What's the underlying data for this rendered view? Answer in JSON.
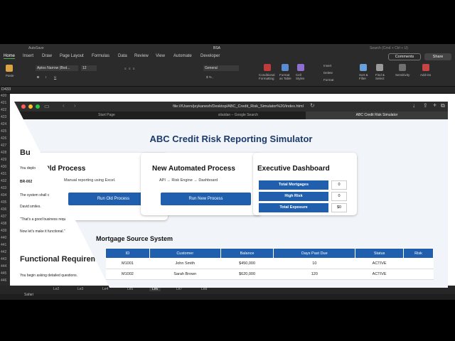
{
  "excel": {
    "autosave_label": "AutoSave",
    "file_name": "BSA",
    "search_placeholder": "Search (Cmd + Ctrl + U)",
    "ribbon_tabs": [
      "Home",
      "Insert",
      "Draw",
      "Page Layout",
      "Formulas",
      "Data",
      "Review",
      "View",
      "Automate",
      "Developer"
    ],
    "comments_label": "Comments",
    "share_label": "Share",
    "paste_label": "Paste",
    "font_name": "Aptos Narrow (Bod...",
    "font_size": "12",
    "number_format": "General",
    "insert_label": "Insert",
    "delete_label": "Delete",
    "format_label": "Format",
    "conditional_label": "Conditional Formatting",
    "format_table_label": "Format as Table",
    "cell_styles_label": "Cell Styles",
    "sort_label": "Sort & Filter",
    "find_label": "Find & Select",
    "sensitivity_label": "Sensitivity",
    "addins_label": "Add-ins",
    "name_box": "D433",
    "row_numbers": [
      "420",
      "421",
      "422",
      "423",
      "424",
      "425",
      "426",
      "427",
      "428",
      "429",
      "430",
      "431",
      "432",
      "433",
      "434",
      "435",
      "436",
      "437",
      "438",
      "439",
      "440",
      "441",
      "442",
      "443",
      "444",
      "445",
      "446"
    ],
    "doc_lines": {
      "heading1": "Bu",
      "l1": "You deplo",
      "l2": "BR-002",
      "l3": "The system shall c",
      "l4": "David smiles.",
      "l5": "“That's a good business requ",
      "l6": "Now let's make it functional.”",
      "heading2": "Functional Requireme",
      "l7": "You begin asking detailed questions."
    },
    "sheet_tabs": [
      "Le2",
      "Le3",
      "Le4",
      "Le5",
      "Le6",
      "Le7",
      "Le8"
    ],
    "active_sheet": "Le6",
    "dock_label": "Safari"
  },
  "safari": {
    "url": "file:///Users/jeykanesh/Desktop/ABC_Credit_Risk_Simulator%20/index.html",
    "tabs": [
      "Start Page",
      "sitaidan – Google Search",
      "ABC Credit Risk Simulator"
    ]
  },
  "page": {
    "title": "ABC Credit Risk Reporting Simulator",
    "old_process": {
      "title": "Old Process",
      "desc": "Manual reporting using Excel.",
      "button": "Run Old Process"
    },
    "new_process": {
      "title": "New Automated Process",
      "desc": "API → Risk Engine → Dashboard",
      "button": "Run New Process"
    },
    "dashboard": {
      "title": "Executive Dashboard",
      "rows": [
        {
          "label": "Total Mortgages",
          "value": "0"
        },
        {
          "label": "High Risk",
          "value": "0"
        },
        {
          "label": "Total Exposure",
          "value": "$0"
        }
      ]
    },
    "source": {
      "title": "Mortgage Source System",
      "headers": [
        "ID",
        "Customer",
        "Balance",
        "Days Past Due",
        "Status",
        "Risk"
      ],
      "rows": [
        [
          "M1001",
          "John Smith",
          "$450,000",
          "10",
          "ACTIVE",
          ""
        ],
        [
          "M1002",
          "Sarah Brown",
          "$620,000",
          "120",
          "ACTIVE",
          ""
        ]
      ]
    }
  }
}
